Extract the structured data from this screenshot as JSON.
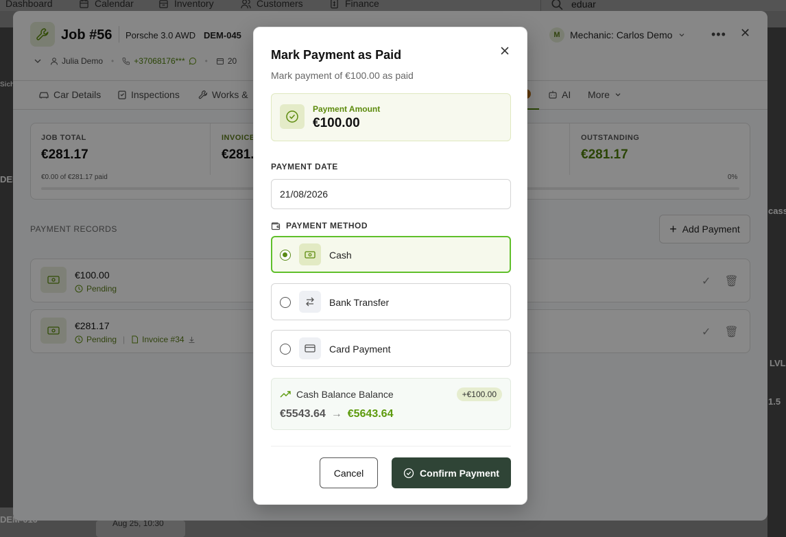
{
  "topnav": {
    "items": [
      {
        "label": "Dashboard",
        "icon": "dashboard-icon"
      },
      {
        "label": "Calendar",
        "icon": "calendar-icon"
      },
      {
        "label": "Inventory",
        "icon": "inventory-icon"
      },
      {
        "label": "Customers",
        "icon": "customers-icon"
      },
      {
        "label": "Finance",
        "icon": "finance-icon"
      }
    ],
    "search_value": "eduar"
  },
  "job": {
    "title": "Job #56",
    "car": "Porsche 3.0 AWD",
    "plate": "DEM-045",
    "mechanic_initial": "M",
    "mechanic": "Mechanic: Carlos Demo",
    "customer": "Julia Demo",
    "phone": "+37068176***",
    "date_partial": "20",
    "tabs": [
      "Car Details",
      "Inspections",
      "Works &",
      "AI",
      "More"
    ],
    "summary": {
      "job_total_label": "JOB TOTAL",
      "job_total": "€281.17",
      "paid_text": "€0.00 of €281.17 paid",
      "invoiced_label": "INVOICE",
      "invoiced": "€281.",
      "outstanding_label": "OUTSTANDING",
      "outstanding": "€281.17",
      "percent": "0%"
    },
    "records_label": "PAYMENT RECORDS",
    "add_payment": "Add Payment",
    "records": [
      {
        "amount": "€100.00",
        "status": "Pending",
        "invoice": ""
      },
      {
        "amount": "€281.17",
        "status": "Pending",
        "invoice": "Invoice #34"
      }
    ]
  },
  "modal": {
    "title": "Mark Payment as Paid",
    "subtitle": "Mark payment of €100.00 as paid",
    "amount_label": "Payment Amount",
    "amount_value": "€100.00",
    "date_label": "PAYMENT DATE",
    "date_value": "21/08/2026",
    "method_label": "PAYMENT METHOD",
    "methods": [
      {
        "label": "Cash",
        "icon": "cash-icon",
        "selected": true
      },
      {
        "label": "Bank Transfer",
        "icon": "transfer-icon",
        "selected": false
      },
      {
        "label": "Card Payment",
        "icon": "card-icon",
        "selected": false
      }
    ],
    "balance": {
      "title": "Cash Balance Balance",
      "badge": "+€100.00",
      "from": "€5543.64",
      "arrow": "→",
      "to": "€5643.64"
    },
    "cancel_label": "Cancel",
    "confirm_label": "Confirm Payment"
  },
  "background_labels": {
    "left_1": "DEM",
    "left_2": "DEM-010",
    "left_3": "Sich",
    "right_1": "cass",
    "right_2": "1.5",
    "right_3": "LVL",
    "bottom_date": "Aug 25, 10:30"
  },
  "colors": {
    "accent_green": "#5c9a0c",
    "confirm_bg": "#2f4436",
    "selected_border": "#5fbf2a"
  }
}
